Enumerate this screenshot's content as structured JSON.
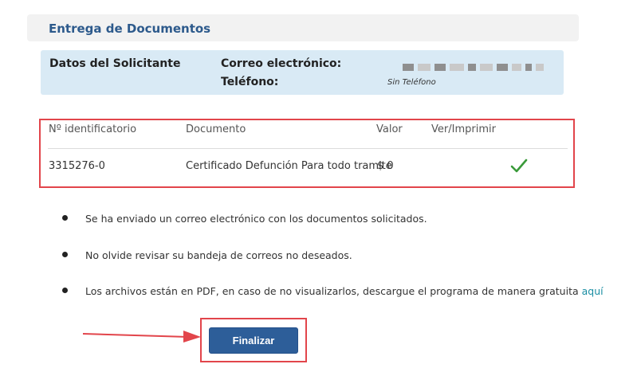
{
  "header": {
    "title": "Entrega de Documentos"
  },
  "applicant": {
    "section_label": "Datos del Solicitante",
    "email_label": "Correo electrónico:",
    "phone_label": "Teléfono:",
    "phone_value": "Sin Teléfono"
  },
  "table": {
    "headers": [
      "Nº identificatorio",
      "Documento",
      "Valor",
      "Ver/Imprimir"
    ],
    "rows": [
      {
        "id": "3315276-0",
        "document": "Certificado Defunción Para todo tramite",
        "value": "$ 0",
        "print_icon": "check-icon"
      }
    ]
  },
  "notes": [
    {
      "text": "Se ha enviado un correo electrónico con los documentos solicitados."
    },
    {
      "text": "No olvide revisar su bandeja de correos no deseados."
    },
    {
      "text": "Los archivos están en PDF, en caso de no visualizarlos, descargue el programa de manera gratuita",
      "link": "aquí"
    }
  ],
  "actions": {
    "finalize_label": "Finalizar"
  },
  "colors": {
    "accent": "#2d5e99",
    "highlight": "#e2454b",
    "check": "#3a9a3a",
    "link": "#1a8ea3"
  }
}
